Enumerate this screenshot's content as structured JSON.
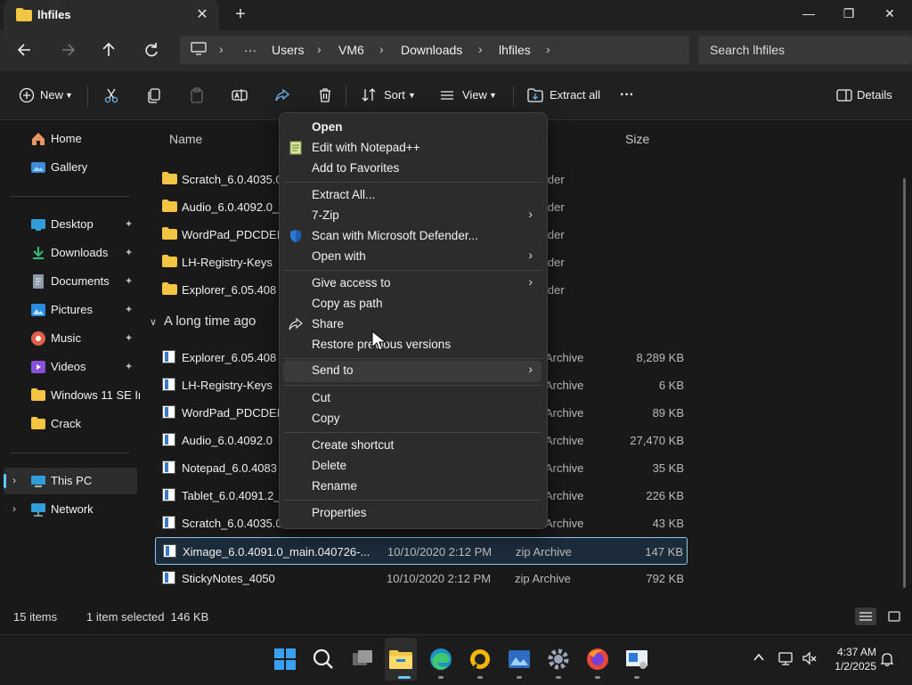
{
  "window": {
    "tab_title": "lhfiles",
    "close_tab": "✕",
    "new_tab": "+",
    "minimize": "—",
    "maximize": "❐",
    "close": "✕"
  },
  "nav": {
    "breadcrumb": [
      "Users",
      "VM6",
      "Downloads",
      "lhfiles"
    ],
    "ellipsis": "···",
    "search_placeholder": "Search lhfiles"
  },
  "toolbar": {
    "new_label": "New",
    "sort_label": "Sort",
    "view_label": "View",
    "extract_label": "Extract all",
    "more_label": "···",
    "details_label": "Details"
  },
  "sidebar": {
    "items": [
      {
        "label": "Home",
        "icon": "home-icon"
      },
      {
        "label": "Gallery",
        "icon": "gallery-icon"
      },
      {
        "label": "Desktop",
        "icon": "desktop-icon",
        "pinned": true
      },
      {
        "label": "Downloads",
        "icon": "downloads-icon",
        "pinned": true
      },
      {
        "label": "Documents",
        "icon": "documents-icon",
        "pinned": true
      },
      {
        "label": "Pictures",
        "icon": "pictures-icon",
        "pinned": true
      },
      {
        "label": "Music",
        "icon": "music-icon",
        "pinned": true
      },
      {
        "label": "Videos",
        "icon": "videos-icon",
        "pinned": true
      },
      {
        "label": "Windows 11 SE Ins",
        "icon": "folder-icon"
      },
      {
        "label": "Crack",
        "icon": "folder-icon"
      },
      {
        "label": "This PC",
        "icon": "this-pc-icon"
      },
      {
        "label": "Network",
        "icon": "network-icon"
      }
    ],
    "pin_glyph": "📌"
  },
  "list": {
    "col_name": "Name",
    "col_size": "Size",
    "group_long_ago": "A long time ago",
    "folders": [
      {
        "name": "Scratch_6.0.4035.0",
        "type": "lder"
      },
      {
        "name": "Audio_6.0.4092.0_",
        "type": "lder"
      },
      {
        "name": "WordPad_PDCDEI",
        "type": "lder"
      },
      {
        "name": "LH-Registry-Keys",
        "type": "lder"
      },
      {
        "name": "Explorer_6.05.408",
        "type": "lder"
      }
    ],
    "archives": [
      {
        "name": "Explorer_6.05.408",
        "type": "Archive",
        "size": "8,289 KB"
      },
      {
        "name": "LH-Registry-Keys",
        "type": "Archive",
        "size": "6 KB"
      },
      {
        "name": "WordPad_PDCDEI",
        "type": "Archive",
        "size": "89 KB"
      },
      {
        "name": "Audio_6.0.4092.0",
        "type": "Archive",
        "size": "27,470 KB"
      },
      {
        "name": "Notepad_6.0.4083",
        "type": "Archive",
        "size": "35 KB"
      },
      {
        "name": "Tablet_6.0.4091.2_",
        "type": "Archive",
        "size": "226 KB"
      },
      {
        "name": "Scratch_6.0.4035.0",
        "type": "Archive",
        "size": "43 KB"
      }
    ],
    "selected": {
      "name": "Ximage_6.0.4091.0_main.040726-...",
      "date": "10/10/2020 2:12 PM",
      "type": "zip Archive",
      "size": "147 KB"
    },
    "last": {
      "name": "StickyNotes_4050",
      "date": "10/10/2020 2:12 PM",
      "type": "zip Archive",
      "size": "792 KB"
    }
  },
  "status": {
    "items_count": "15 items",
    "selection": "1 item selected  146 KB"
  },
  "context_menu": {
    "open": "Open",
    "edit_notepad": "Edit with Notepad++",
    "add_favorites": "Add to Favorites",
    "extract_all": "Extract All...",
    "seven_zip": "7-Zip",
    "scan_defender": "Scan with Microsoft Defender...",
    "open_with": "Open with",
    "give_access": "Give access to",
    "copy_path": "Copy as path",
    "share": "Share",
    "restore": "Restore previous versions",
    "send_to": "Send to",
    "cut": "Cut",
    "copy": "Copy",
    "create_shortcut": "Create shortcut",
    "delete": "Delete",
    "rename": "Rename",
    "properties": "Properties",
    "submenu_arrow": "›"
  },
  "taskbar": {
    "time": "4:37 AM",
    "date": "1/2/2025"
  },
  "colors": {
    "accent": "#60cdff",
    "folder": "#f4c542",
    "selection_border": "#8fc7ef"
  }
}
